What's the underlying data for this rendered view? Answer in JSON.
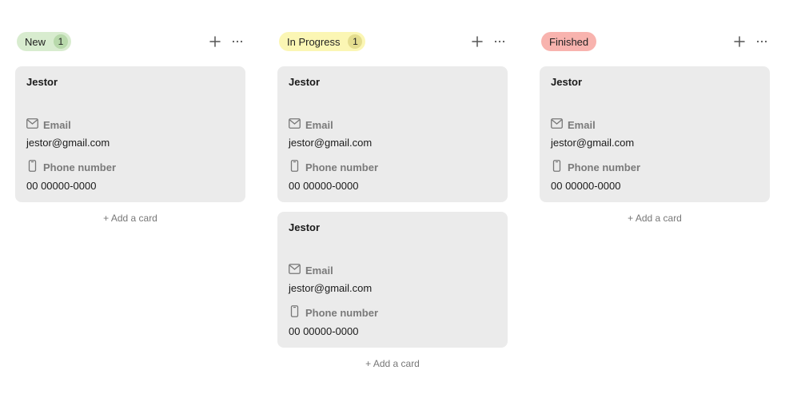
{
  "columns": [
    {
      "id": "new",
      "label": "New",
      "count": "1",
      "pill_color": "#d8eccf",
      "count_color": "#b8d9ab",
      "add_label": "+ Add a card",
      "cards": [
        {
          "title": "Jestor",
          "email_label": "Email",
          "email": "jestor@gmail.com",
          "phone_label": "Phone number",
          "phone": "00 00000-0000"
        }
      ]
    },
    {
      "id": "in-progress",
      "label": "In Progress",
      "count": "1",
      "pill_color": "#fbf6b4",
      "count_color": "#e4dd8f",
      "add_label": "+ Add a card",
      "cards": [
        {
          "title": "Jestor",
          "email_label": "Email",
          "email": "jestor@gmail.com",
          "phone_label": "Phone number",
          "phone": "00 00000-0000"
        },
        {
          "title": "Jestor",
          "email_label": "Email",
          "email": "jestor@gmail.com",
          "phone_label": "Phone number",
          "phone": "00 00000-0000"
        }
      ]
    },
    {
      "id": "finished",
      "label": "Finished",
      "count": "",
      "pill_color": "#f8b3ae",
      "count_color": "",
      "add_label": "+ Add a card",
      "cards": [
        {
          "title": "Jestor",
          "email_label": "Email",
          "email": "jestor@gmail.com",
          "phone_label": "Phone number",
          "phone": "00 00000-0000"
        }
      ]
    }
  ],
  "icons": {
    "add": "plus-icon",
    "more": "more-horizontal-icon",
    "email": "mail-icon",
    "phone": "smartphone-icon"
  }
}
